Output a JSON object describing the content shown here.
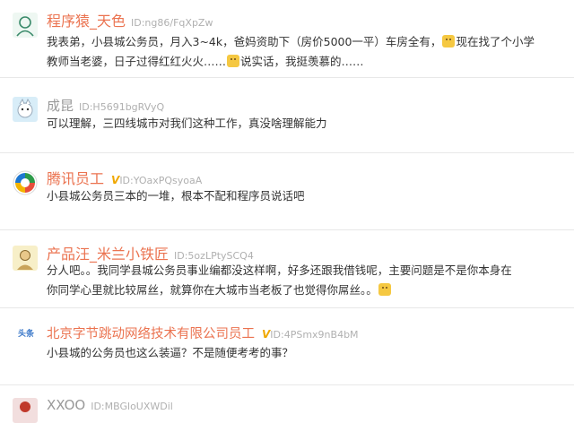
{
  "comments": [
    {
      "name": "程序猿_天色",
      "uid": "ID:ng86/FqXpZw",
      "verified": "",
      "text_lines": [
        "我表弟，小县城公务员，月入3~4k，爸妈资助下（房价5000一平）车房全有，",
        "现在找了个小学",
        "教师当老婆，日子过得红红火火……",
        "说实话，我挺羡慕的……"
      ]
    },
    {
      "name": "成昆",
      "uid": "ID:H5691bgRVyQ",
      "verified": "",
      "text_lines": [
        "可以理解，三四线城市对我们这种工作，真没啥理解能力"
      ]
    },
    {
      "name": "腾讯员工",
      "uid": "ID:YOaxPQsyoaA",
      "verified": "V",
      "text_lines": [
        "小县城公务员三本的一堆，根本不配和程序员说话吧"
      ]
    },
    {
      "name": "产品汪_米兰小铁匠",
      "uid": "ID:5ozLPtySCQ4",
      "verified": "",
      "text_lines": [
        "分人吧。。我同学县城公务员事业编都没这样啊，好多还跟我借钱呢，主要问题是不是你本身在",
        "你同学心里就比较屌丝，就算你在大城市当老板了也觉得你屌丝。。"
      ]
    },
    {
      "name": "北京字节跳动网络技术有限公司员工",
      "uid": "ID:4PSmx9nB4bM",
      "verified": "V",
      "avatar_text": "头条",
      "text_lines": [
        "小县城的公务员也这么装逼？不是随便考考的事？"
      ]
    },
    {
      "name": "XXOO",
      "uid": "ID:MBGloUXWDil",
      "verified": "",
      "text_lines": []
    }
  ],
  "colors": {
    "name": "#eb7350",
    "name_muted": "#999999",
    "verified": "#f0a800",
    "text": "#333333",
    "uid": "#b0b0b0"
  },
  "icons": [
    "avatar-sketch-icon",
    "avatar-cartoon-icon",
    "tencent-logo-icon",
    "avatar-person-icon",
    "toutiao-logo-icon",
    "avatar-partial-icon",
    "emoji-smile-icon"
  ]
}
